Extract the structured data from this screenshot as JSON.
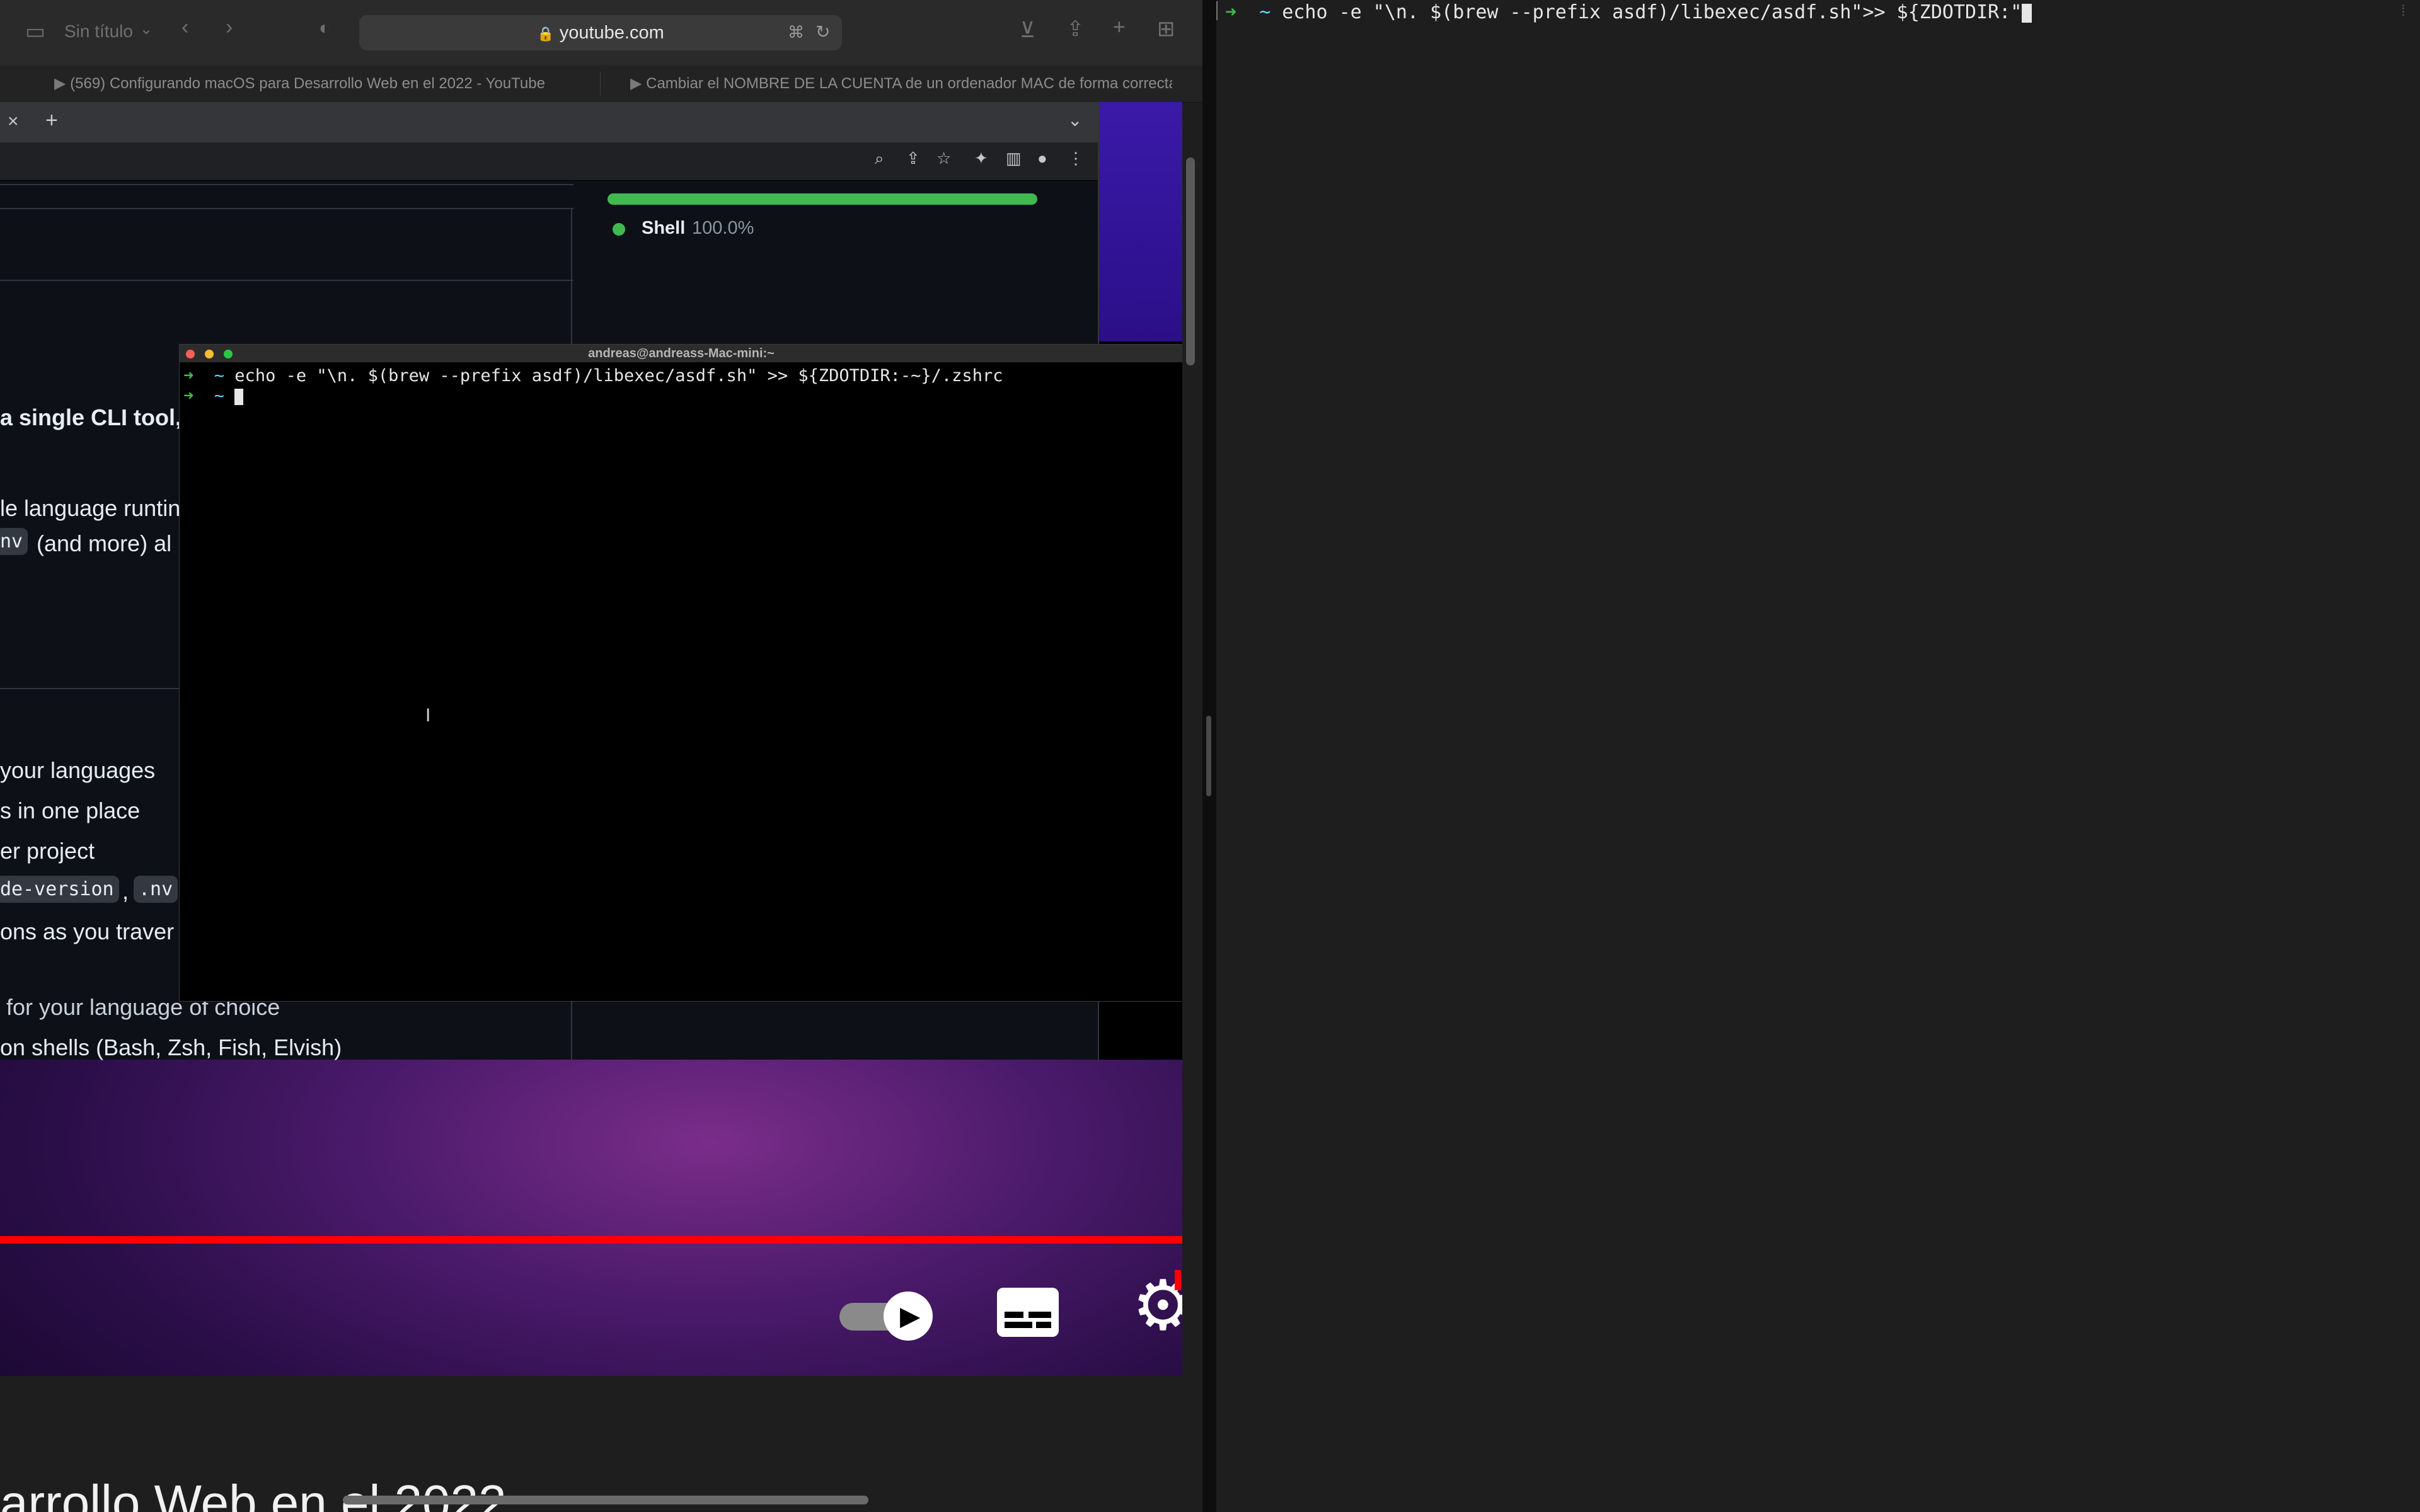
{
  "safari": {
    "sidebar_label": "Sin título",
    "url": "youtube.com",
    "tabs": [
      {
        "title": "(569) Configurando macOS para Desarrollo Web en el 2022 - YouTube"
      },
      {
        "title": "Cambiar el NOMBRE DE LA CUENTA de un ordenador MAC de forma correcta..."
      }
    ]
  },
  "github": {
    "language_name": "Shell",
    "language_percent": "100.0%",
    "language_progress": 1.0,
    "texts": [
      "a single CLI tool,",
      "le language runtin",
      "(and more) al",
      "your languages",
      "s in one place",
      "er project",
      "ons as you traver",
      "for your language of choice",
      "on shells (Bash, Zsh, Fish, Elvish)"
    ],
    "codes": [
      "nv",
      "de-version",
      ".nv"
    ],
    "code_comma": ","
  },
  "inner_terminal": {
    "title": "andreas@andreass-Mac-mini:~",
    "prompt_arrow": "➜",
    "prompt_dir": "~",
    "line1": " echo -e \"\\n. $(brew --prefix asdf)/libexec/asdf.sh\" >> ${ZDOTDIR:-~}/.zshrc"
  },
  "video": {
    "title_fragment": "arrollo Web en el 2022",
    "progress": 1.0
  },
  "right_terminal": {
    "prompt_arrow": "➜",
    "prompt_dir": "~",
    "command": " echo -e \"\\n. $(brew --prefix asdf)/libexec/asdf.sh\">> ${ZDOTDIR:\""
  },
  "colors": {
    "accent_green": "#3fb950",
    "youtube_red": "#ff0000",
    "terminal_bg": "#1e1e1e"
  }
}
